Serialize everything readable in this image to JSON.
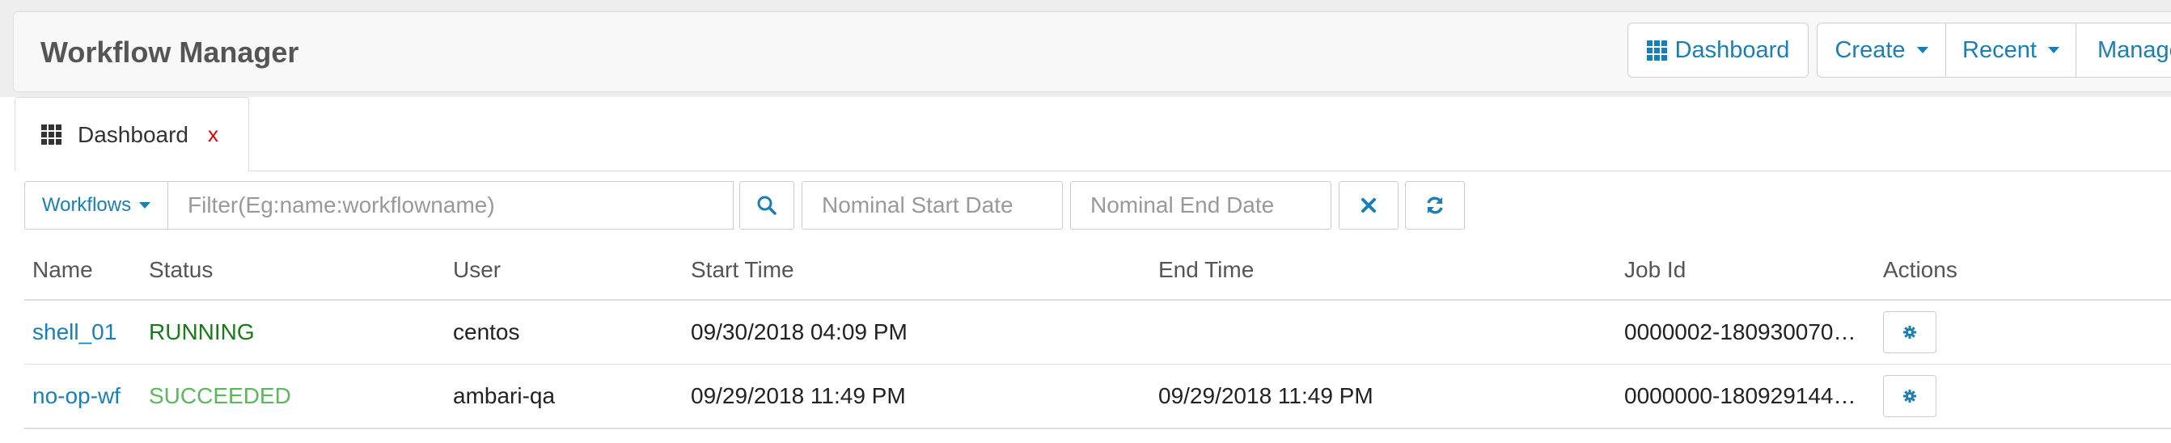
{
  "header": {
    "title": "Workflow Manager",
    "nav": {
      "dashboard": "Dashboard",
      "create": "Create",
      "recent": "Recent",
      "manage": "Manage"
    }
  },
  "tab": {
    "label": "Dashboard",
    "close": "x"
  },
  "filters": {
    "type": "Workflows",
    "search_placeholder": "Filter(Eg:name:workflowname)",
    "start_placeholder": "Nominal Start Date",
    "end_placeholder": "Nominal End Date"
  },
  "table": {
    "columns": [
      "Name",
      "Status",
      "User",
      "Start Time",
      "End Time",
      "Job Id",
      "Actions"
    ],
    "rows": [
      {
        "name": "shell_01",
        "status": "RUNNING",
        "user": "centos",
        "start": "09/30/2018 04:09 PM",
        "end": "",
        "job_id": "0000002-180930070…"
      },
      {
        "name": "no-op-wf",
        "status": "SUCCEEDED",
        "user": "ambari-qa",
        "start": "09/29/2018 11:49 PM",
        "end": "09/29/2018 11:49 PM",
        "job_id": "0000000-180929144…"
      }
    ]
  },
  "colors": {
    "accent": "#1a7fb5",
    "running": "#1a7a1a",
    "succeeded": "#5cb85c",
    "close": "#e00000"
  }
}
